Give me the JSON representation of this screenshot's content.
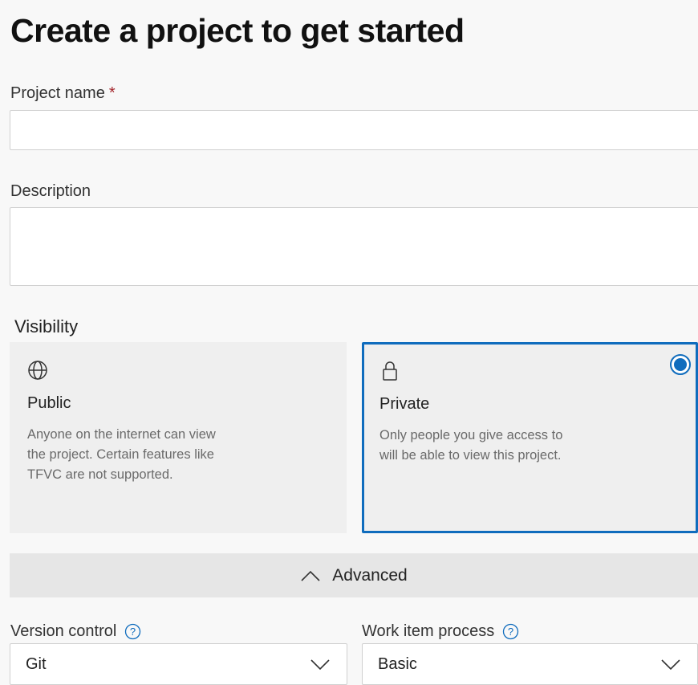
{
  "page": {
    "title": "Create a project to get started"
  },
  "project_name": {
    "label": "Project name",
    "required_marker": "*",
    "value": ""
  },
  "description": {
    "label": "Description",
    "value": ""
  },
  "visibility": {
    "label": "Visibility",
    "selected": "private",
    "options": [
      {
        "id": "public",
        "icon": "globe-icon",
        "title": "Public",
        "description": "Anyone on the internet can view the project. Certain features like TFVC are not supported."
      },
      {
        "id": "private",
        "icon": "lock-icon",
        "title": "Private",
        "description": "Only people you give access to will be able to view this project."
      }
    ]
  },
  "advanced": {
    "label": "Advanced",
    "expanded": true,
    "icon": "chevron-up-icon"
  },
  "version_control": {
    "label": "Version control",
    "icon": "help-icon",
    "value": "Git"
  },
  "work_item_process": {
    "label": "Work item process",
    "icon": "help-icon",
    "value": "Basic"
  },
  "colors": {
    "accent": "#0f6cbd",
    "required": "#a4262c",
    "background": "#f8f8f8",
    "card_background": "#efefef"
  }
}
